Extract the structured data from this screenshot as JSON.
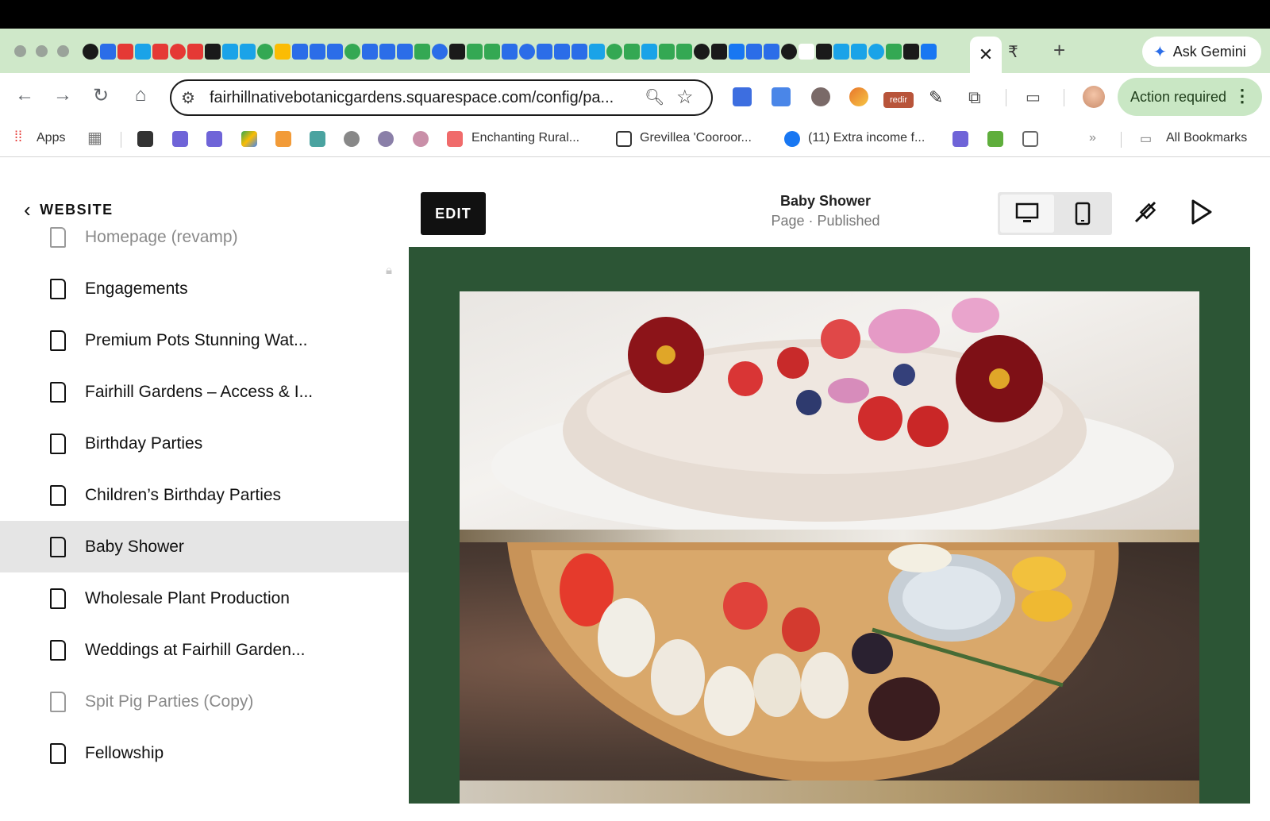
{
  "browser": {
    "active_tab_close": "✕",
    "new_tab": "+",
    "ask_gemini": "Ask Gemini",
    "url": "fairhillnativebotanicgardens.squarespace.com/config/pa...",
    "action_required": "Action required",
    "ext_redir_label": "redir",
    "favicon_colors": [
      "#1a1a1a",
      "#2b6de8",
      "#e53935",
      "#1aa3e8",
      "#e53935",
      "#e53935",
      "#e53935",
      "#1a1a1a",
      "#1aa3e8",
      "#1aa3e8",
      "#34a853",
      "#fbbc04",
      "#2b6de8",
      "#2b6de8",
      "#2b6de8",
      "#34a853",
      "#2b6de8",
      "#2b6de8",
      "#2b6de8",
      "#34a853",
      "#2b6de8",
      "#1a1a1a",
      "#34a853",
      "#34a853",
      "#2b6de8",
      "#2b6de8",
      "#2b6de8",
      "#2b6de8",
      "#2b6de8",
      "#1aa3e8",
      "#34a853",
      "#34a853",
      "#1aa3e8",
      "#34a853",
      "#34a853",
      "#1a1a1a",
      "#1a1a1a",
      "#1877f2",
      "#2b6de8",
      "#2b6de8",
      "#1a1a1a",
      "#ffffff",
      "#1a1a1a",
      "#1aa3e8",
      "#1aa3e8",
      "#1aa3e8",
      "#34a853",
      "#1a1a1a",
      "#1877f2"
    ]
  },
  "bookmarks": {
    "apps": "Apps",
    "items": [
      "Enchanting Rural...",
      "Grevillea 'Cooroor...",
      "(11) Extra income f..."
    ],
    "more": "»",
    "all_bookmarks": "All Bookmarks"
  },
  "sidebar": {
    "back_label": "WEBSITE",
    "pages": [
      {
        "label": "Homepage (revamp)",
        "muted": true
      },
      {
        "label": "Engagements"
      },
      {
        "label": "Premium Pots Stunning Wat..."
      },
      {
        "label": "Fairhill Gardens – Access & I..."
      },
      {
        "label": "Birthday Parties"
      },
      {
        "label": "Children’s Birthday Parties"
      },
      {
        "label": "Baby Shower",
        "selected": true
      },
      {
        "label": "Wholesale Plant Production"
      },
      {
        "label": "Weddings at Fairhill Garden..."
      },
      {
        "label": "Spit Pig Parties (Copy)",
        "muted": true
      },
      {
        "label": "Fellowship"
      }
    ]
  },
  "preview": {
    "edit_label": "EDIT",
    "page_title": "Baby Shower",
    "page_status": "Page · Published",
    "background_color": "#2c5535"
  }
}
